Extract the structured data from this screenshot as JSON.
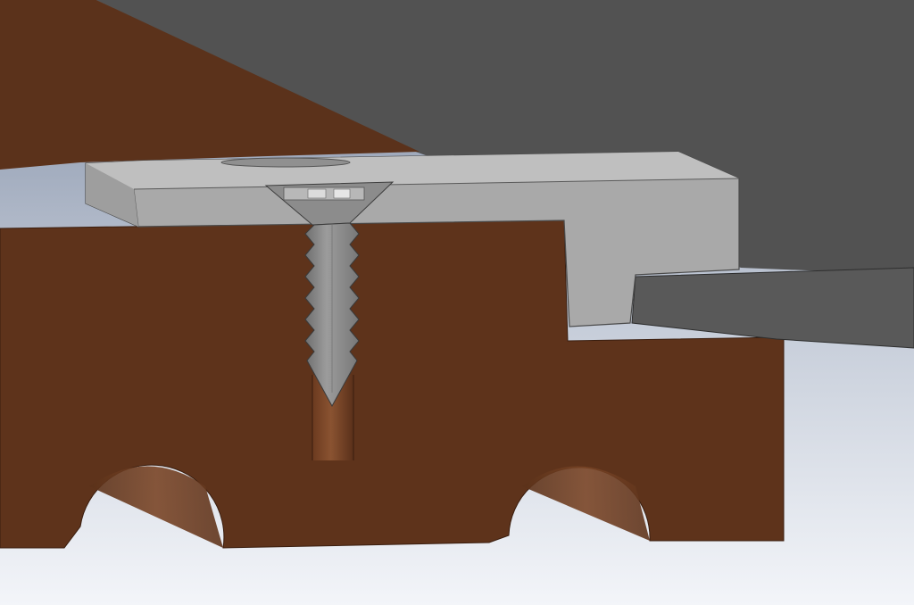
{
  "scene": {
    "type": "cad-section-view",
    "components": [
      {
        "id": "deck-board-top",
        "color": "#5a5a5a"
      },
      {
        "id": "timber-joist",
        "color": "#5e331b"
      },
      {
        "id": "hidden-fastener-clip",
        "color": "#a9a9a9"
      },
      {
        "id": "countersunk-screw",
        "color": "#8a8a8a"
      },
      {
        "id": "pilot-hole",
        "color": "#7a4526"
      },
      {
        "id": "adjacent-deck-board",
        "color": "#595959"
      }
    ],
    "background": {
      "top": "#7d8aa1",
      "bottom": "#f2f4f8"
    }
  }
}
